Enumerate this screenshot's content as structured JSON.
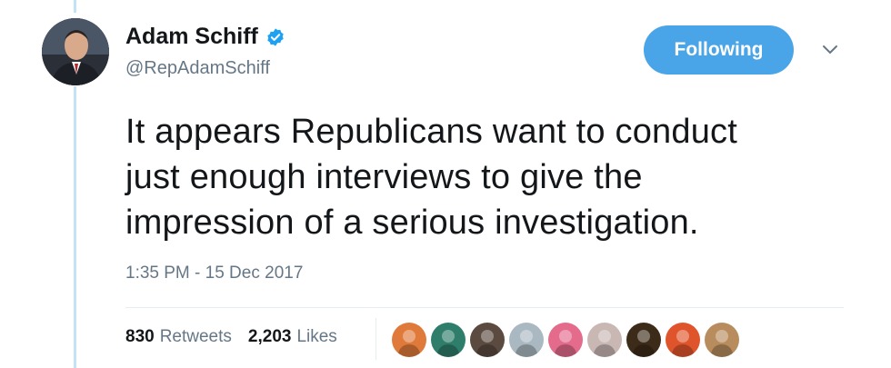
{
  "author": {
    "name": "Adam Schiff",
    "handle": "@RepAdamSchiff",
    "verified": true,
    "avatar_icon": "profile-photo-icon"
  },
  "follow_button": {
    "label": "Following",
    "color": "#4aa4e8"
  },
  "menu_caret_icon": "chevron-down-icon",
  "tweet": {
    "text": "It appears Republicans want to conduct\njust enough interviews to give the\nimpression of a serious investigation.",
    "timestamp": "1:35 PM - 15 Dec 2017"
  },
  "stats": {
    "retweets_count": "830",
    "retweets_label": "Retweets",
    "likes_count": "2,203",
    "likes_label": "Likes"
  },
  "liker_avatars": [
    {
      "icon": "liker-avatar-icon",
      "color": "#e07a3a"
    },
    {
      "icon": "liker-avatar-icon",
      "color": "#2f7d6b"
    },
    {
      "icon": "liker-avatar-icon",
      "color": "#5a4a3f"
    },
    {
      "icon": "liker-avatar-icon",
      "color": "#aab8c2"
    },
    {
      "icon": "liker-avatar-icon",
      "color": "#e46b8c"
    },
    {
      "icon": "liker-avatar-icon",
      "color": "#c9b7b4"
    },
    {
      "icon": "liker-avatar-icon",
      "color": "#3d2b1a"
    },
    {
      "icon": "liker-avatar-icon",
      "color": "#e0542b"
    },
    {
      "icon": "liker-avatar-icon",
      "color": "#b98c5e"
    }
  ],
  "colors": {
    "verified_badge": "#1da1f2",
    "thread_line": "#c2e2f5",
    "secondary_text": "#657786"
  }
}
